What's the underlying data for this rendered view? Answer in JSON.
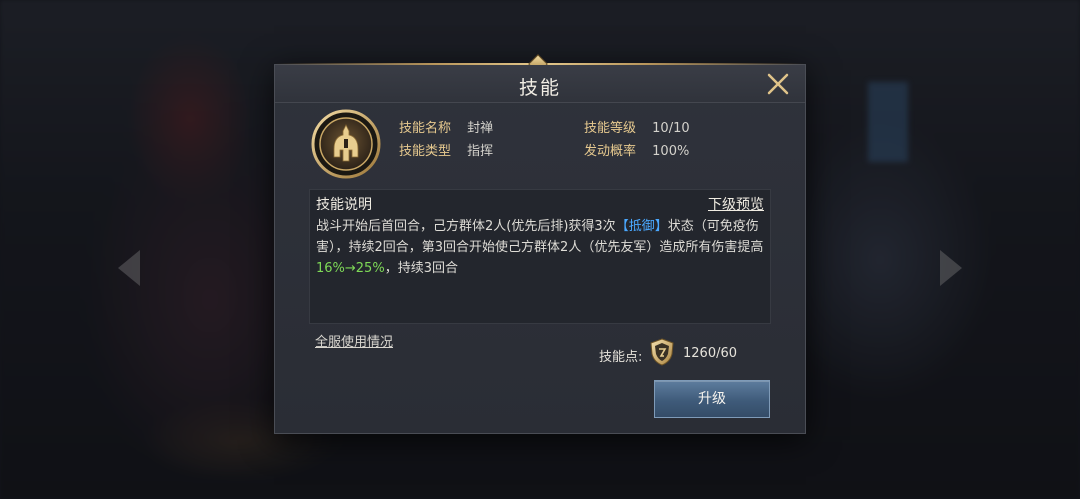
{
  "dialog": {
    "title": "技能",
    "close_icon": "close-icon"
  },
  "skill": {
    "icon": "helmet-emblem-icon",
    "name_label": "技能名称",
    "name_value": "封禅",
    "type_label": "技能类型",
    "type_value": "指挥",
    "level_label": "技能等级",
    "level_value": "10/10",
    "chance_label": "发动概率",
    "chance_value": "100%"
  },
  "description": {
    "title": "技能说明",
    "preview_link": "下级预览",
    "segments": [
      "战斗开始后首回合，己方群体2人(优先后排)获得3次",
      "【抵御】",
      "状态（可免疫伤害），持续2回合，第3回合开始使己方群体2人（优先友军）造成所有伤害提高",
      "16%→25%",
      "，持续3回合"
    ]
  },
  "footer": {
    "server_usage_link": "全服使用情况",
    "points_label": "技能点:",
    "points_icon": "skill-point-shield-icon",
    "points_value": "1260/60",
    "upgrade_button": "升级"
  },
  "colors": {
    "gold_label": "#e6c98f",
    "keyword_blue": "#4aa8ff",
    "keyword_green": "#7ed957",
    "button_blue": "#3f5b7a"
  }
}
